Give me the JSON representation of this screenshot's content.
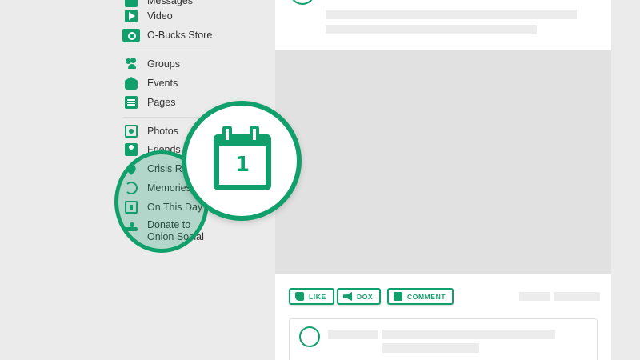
{
  "sidebar": {
    "items": [
      {
        "label": "Messages"
      },
      {
        "label": "Video"
      },
      {
        "label": "O-Bucks Store"
      },
      {
        "label": "Groups"
      },
      {
        "label": "Events"
      },
      {
        "label": "Pages"
      },
      {
        "label": "Photos"
      },
      {
        "label": "Friends L"
      },
      {
        "label": "Crisis Re"
      },
      {
        "label": "Memories"
      },
      {
        "label": "On This Day"
      },
      {
        "label": "Donate to"
      },
      {
        "label": "Onion Social"
      }
    ]
  },
  "badge": {
    "calendar_number": "1"
  },
  "post": {
    "actions": [
      {
        "label": "LIKE"
      },
      {
        "label": "DOX"
      },
      {
        "label": "COMMENT"
      }
    ]
  },
  "colors": {
    "accent": "#11a06c",
    "background": "#ebebeb",
    "card": "#ffffff"
  }
}
